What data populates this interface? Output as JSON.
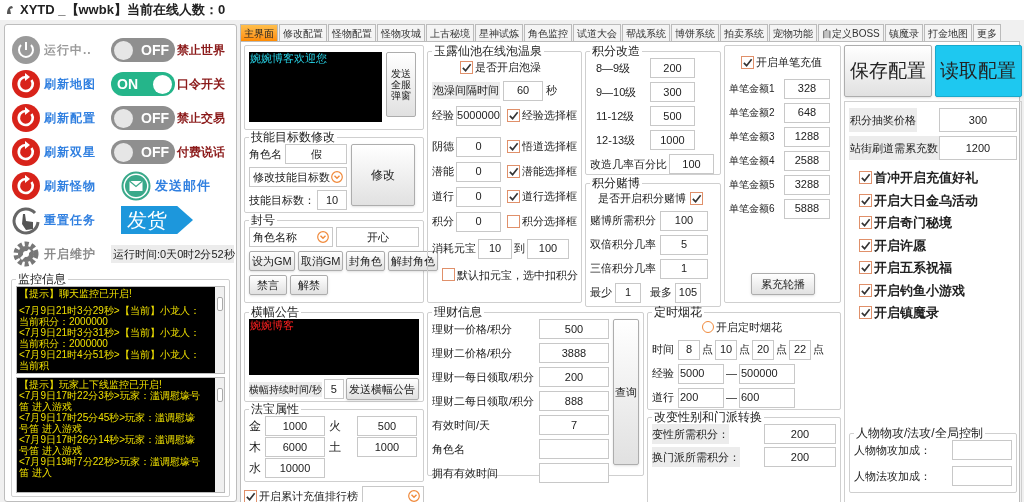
{
  "window": {
    "title": "XYTD _【wwbk】当前在线人数：0"
  },
  "left_actions": [
    {
      "label": "运行中..",
      "kind": "power"
    },
    {
      "label": "刷新地图",
      "kind": "refresh"
    },
    {
      "label": "刷新配置",
      "kind": "refresh"
    },
    {
      "label": "刷新双星",
      "kind": "refresh"
    },
    {
      "label": "刷新怪物",
      "kind": "refresh"
    },
    {
      "label": "重置任务",
      "kind": "hand"
    },
    {
      "label": "开启维护",
      "kind": "gear"
    }
  ],
  "toggles": [
    {
      "label": "禁止世界",
      "on": false,
      "text": "OFF"
    },
    {
      "label": "口令开关",
      "on": true,
      "text": "ON"
    },
    {
      "label": "禁止交易",
      "on": false,
      "text": "OFF"
    },
    {
      "label": "付费说话",
      "on": false,
      "text": "OFF"
    }
  ],
  "mail": {
    "label": "发送邮件"
  },
  "ship_button": "发货",
  "runtime": "运行时间:0天0时2分52秒",
  "monitor": {
    "title": "监控信息",
    "chat_log": [
      "【提示】聊天监控已开启!",
      "<7月9日21时3分29秒>【当前】小龙人：当前积分：2000000",
      "<7月9日21时3分31秒>【当前】小龙人：当前积分：2000000",
      "<7月9日21时4分51秒>【当前】小龙人：当前积"
    ],
    "login_log": [
      "【提示】玩家上下线监控已开启!",
      "<7月9日17时22分3秒>玩家：滥调慰壕号笛 进入游戏",
      "<7月9日17时25分45秒>玩家：滥调慰壕号笛 进入游戏",
      "<7月9日17时26分14秒>玩家：滥调慰壕号笛 进入游戏",
      "<7月9日19时7分22秒>玩家：滥调慰壕号笛 进入"
    ]
  },
  "tabs": [
    {
      "label": "主界面",
      "selected": true
    },
    {
      "label": "修改配置",
      "selected": false
    },
    {
      "label": "怪物配置",
      "selected": false
    },
    {
      "label": "怪物攻城",
      "selected": false
    },
    {
      "label": "上古秘境",
      "selected": false
    },
    {
      "label": "星神试炼",
      "selected": false
    },
    {
      "label": "角色监控",
      "selected": false
    },
    {
      "label": "试道大会",
      "selected": false
    },
    {
      "label": "帮战系统",
      "selected": false
    },
    {
      "label": "博饼系统",
      "selected": false
    },
    {
      "label": "拍卖系统",
      "selected": false
    },
    {
      "label": "宠物功能",
      "selected": false
    },
    {
      "label": "自定义BOSS",
      "selected": false
    },
    {
      "label": "镇魔录",
      "selected": false
    },
    {
      "label": "打金地图",
      "selected": false
    },
    {
      "label": "更多",
      "selected": false
    }
  ],
  "welcome": {
    "message": "婉婉博客欢迎您",
    "button": "发送全服弹窗"
  },
  "skill_target": {
    "title": "技能目标数修改",
    "name_label": "角色名",
    "name_value": "假",
    "select": "修改技能目标数",
    "count_label": "技能目标数：",
    "count_value": "10",
    "button": "修改"
  },
  "ban": {
    "title": "封号",
    "select": "角色名称",
    "value": "开心",
    "buttons": [
      "设为GM",
      "取消GM",
      "封角色",
      "解封角色",
      "禁言",
      "解禁"
    ]
  },
  "hot_spring": {
    "title": "玉露仙池在线泡温泉",
    "enable": {
      "label": "是否开启泡澡",
      "checked": true
    },
    "interval_label": "泡澡间隔时间",
    "interval_value": "60",
    "interval_unit": "秒",
    "rows": [
      {
        "label": "经验",
        "value": "5000000",
        "check_label": "经验选择框",
        "checked": true
      },
      {
        "label": "阴德",
        "value": "0",
        "check_label": "悟道选择框",
        "checked": true
      },
      {
        "label": "潜能",
        "value": "0",
        "check_label": "潜能选择框",
        "checked": true
      },
      {
        "label": "道行",
        "value": "0",
        "check_label": "道行选择框",
        "checked": true
      },
      {
        "label": "积分",
        "value": "0",
        "check_label": "积分选择框",
        "checked": false
      }
    ],
    "cost_label": "消耗元宝",
    "cost_from": "10",
    "cost_to_label": "到",
    "cost_to": "100",
    "default": {
      "label": "默认扣元宝，选中扣积分",
      "checked": false
    }
  },
  "upgrade": {
    "title": "积分改造",
    "rows": [
      {
        "label": "8—9级",
        "value": "200"
      },
      {
        "label": "9—10级",
        "value": "300"
      },
      {
        "label": "11-12级",
        "value": "500"
      },
      {
        "label": "12-13级",
        "value": "1000"
      }
    ],
    "rate_label": "改造几率百分比",
    "rate_value": "100"
  },
  "gamble": {
    "title": "积分赌博",
    "enable": {
      "label": "是否开启积分赌博",
      "checked": true
    },
    "rows": [
      {
        "label": "赌博所需积分",
        "value": "100"
      },
      {
        "label": "双倍积分几率",
        "value": "5"
      },
      {
        "label": "三倍积分几率",
        "value": "1"
      }
    ],
    "min_label": "最少",
    "min_value": "1",
    "max_label": "最多",
    "max_value": "105"
  },
  "single_recharge": {
    "enable": {
      "label": "开启单笔充值",
      "checked": true
    },
    "rows": [
      {
        "label": "单笔金额1",
        "value": "328"
      },
      {
        "label": "单笔金额2",
        "value": "648"
      },
      {
        "label": "单笔金额3",
        "value": "1288"
      },
      {
        "label": "单笔金额4",
        "value": "2588"
      },
      {
        "label": "单笔金额5",
        "value": "3288"
      },
      {
        "label": "单笔金额6",
        "value": "5888"
      }
    ],
    "button": "累充轮播"
  },
  "config_buttons": [
    {
      "label": "保存配置",
      "kind": "save"
    },
    {
      "label": "读取配置",
      "kind": "load"
    }
  ],
  "settings": {
    "rows": [
      {
        "label": "积分抽奖价格",
        "value": "300"
      },
      {
        "label": "站街刷道需累充数",
        "value": "1200"
      }
    ],
    "options": [
      {
        "label": "首冲开启充值好礼",
        "checked": true
      },
      {
        "label": "开启大日金乌活动",
        "checked": true
      },
      {
        "label": "开启奇门秘境",
        "checked": true
      },
      {
        "label": "开启许愿",
        "checked": true
      },
      {
        "label": "开启五系祝福",
        "checked": true
      },
      {
        "label": "开启钓鱼小游戏",
        "checked": true
      },
      {
        "label": "开启镇魔录",
        "checked": true
      }
    ],
    "attack": {
      "title": "人物物攻/法攻/全局控制",
      "rows": [
        {
          "label": "人物物攻加成："
        },
        {
          "label": "人物法攻加成："
        }
      ]
    }
  },
  "banner": {
    "title": "横幅公告",
    "message": "婉婉博客",
    "duration_label": "横幅持续时间/秒",
    "duration_value": "5",
    "button": "发送横幅公告"
  },
  "treasure": {
    "title": "法宝属性",
    "items": [
      {
        "label": "金",
        "value": "1000"
      },
      {
        "label": "火",
        "value": "500"
      },
      {
        "label": "木",
        "value": "6000"
      },
      {
        "label": "土",
        "value": "1000"
      },
      {
        "label": "水",
        "value": "10000"
      }
    ]
  },
  "ranking": {
    "label": "开启累计充值排行榜",
    "checked": true
  },
  "finance": {
    "title": "理财信息",
    "rows": [
      {
        "label": "理财一价格/积分",
        "value": "500"
      },
      {
        "label": "理财二价格/积分",
        "value": "3888"
      },
      {
        "label": "理财一每日领取/积分",
        "value": "200"
      },
      {
        "label": "理财二每日领取/积分",
        "value": "888"
      },
      {
        "label": "有效时间/天",
        "value": "7"
      },
      {
        "label": "角色名"
      },
      {
        "label": "拥有有效时间"
      }
    ],
    "button": "查询"
  },
  "fireworks": {
    "title": "定时烟花",
    "enable": {
      "label": "开启定时烟花",
      "selected": false
    },
    "time_label": "时间",
    "times": [
      {
        "value": "8",
        "unit": "点"
      },
      {
        "value": "10",
        "unit": "点"
      },
      {
        "value": "20",
        "unit": "点"
      },
      {
        "value": "22",
        "unit": "点"
      }
    ],
    "ranges": [
      {
        "label": "经验",
        "from": "5000",
        "sep": "—",
        "to": "500000"
      },
      {
        "label": "道行",
        "from": "200",
        "sep": "—",
        "to": "600"
      }
    ]
  },
  "transfer": {
    "title": "改变性别和门派转换",
    "rows": [
      {
        "label": "变性所需积分：",
        "value": "200"
      },
      {
        "label": "换门派所需积分：",
        "value": "200"
      }
    ]
  }
}
